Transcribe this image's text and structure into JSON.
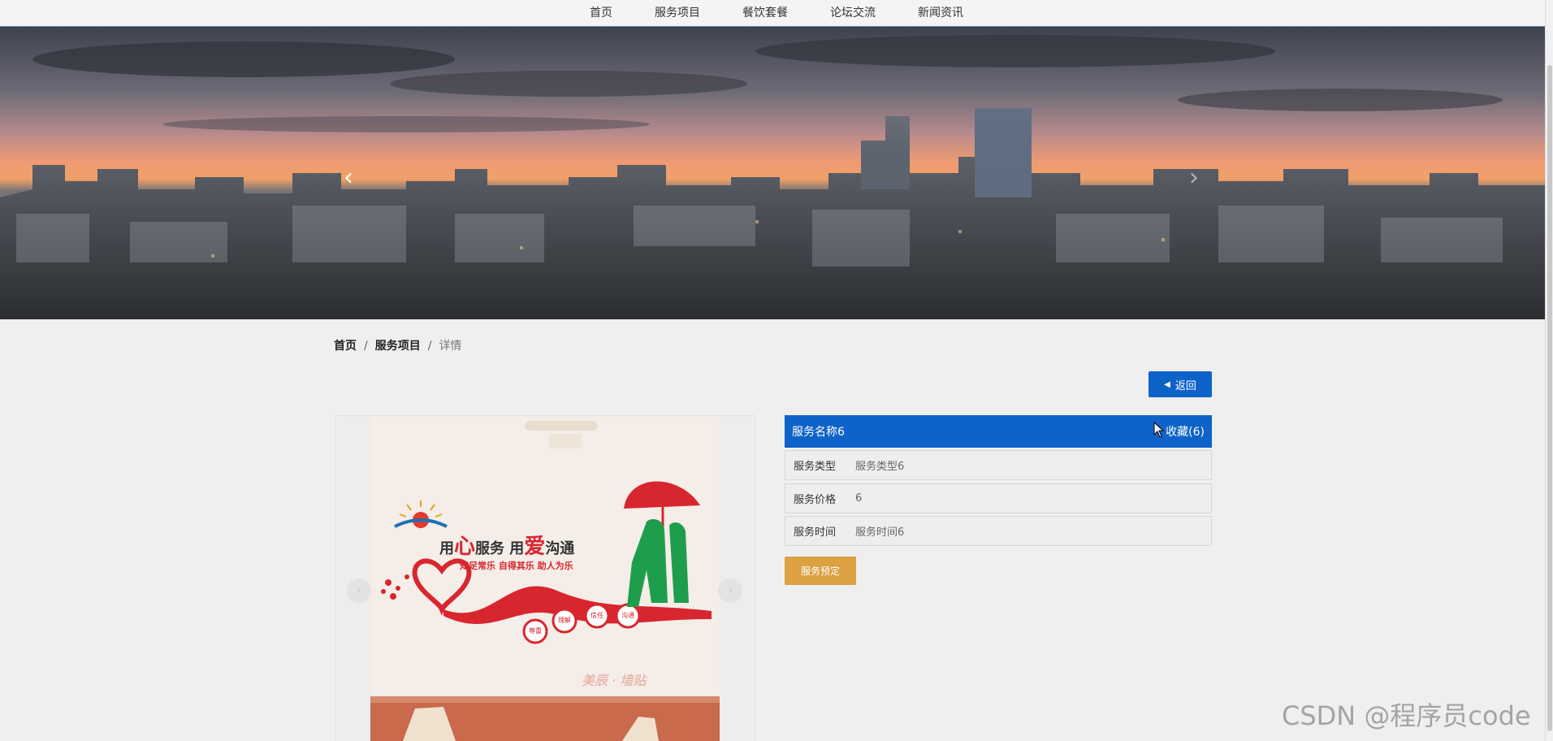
{
  "nav": {
    "items": [
      {
        "label": "首页"
      },
      {
        "label": "服务项目"
      },
      {
        "label": "餐饮套餐"
      },
      {
        "label": "论坛交流"
      },
      {
        "label": "新闻资讯"
      }
    ]
  },
  "banner": {
    "prev_icon": "chevron-left-icon",
    "next_icon": "chevron-right-icon",
    "slide_count": 1,
    "active_slide": 1
  },
  "breadcrumb": {
    "items": [
      "首页",
      "服务项目",
      "详情"
    ],
    "separator": "/"
  },
  "back_button": {
    "label": "返回",
    "icon": "caret-left-icon"
  },
  "detail": {
    "title": "服务名称6",
    "favorite_label": "收藏(6)",
    "rows": [
      {
        "label": "服务类型",
        "value": "服务类型6"
      },
      {
        "label": "服务价格",
        "value": "6"
      },
      {
        "label": "服务时间",
        "value": "服务时间6"
      }
    ],
    "book_button": "服务预定"
  },
  "poster": {
    "headline_a": "用",
    "headline_b": "心",
    "headline_c": "服务  用",
    "headline_d": "爱",
    "headline_e": "沟通",
    "subline": "知足常乐 自得其乐 助人为乐",
    "badges": [
      "尊重",
      "理解",
      "信任",
      "沟通"
    ],
    "brand": "美辰 · 墙贴"
  },
  "watermark": "CSDN @程序员code",
  "colors": {
    "primary": "#0e63c8",
    "accent": "#dba143",
    "poster_red": "#d8262f",
    "poster_green": "#1e9e4c"
  }
}
